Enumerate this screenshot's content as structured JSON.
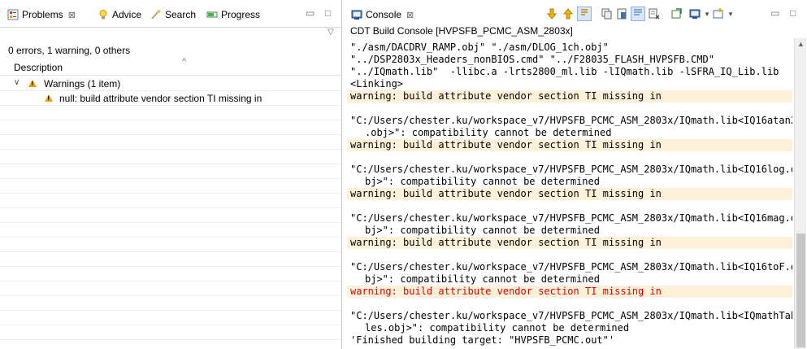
{
  "left": {
    "tabs": [
      {
        "label": "Problems",
        "close": "⊠",
        "icon": "problems-icon"
      },
      {
        "label": "Advice",
        "icon": "lightbulb-icon"
      },
      {
        "label": "Search",
        "icon": "search-icon"
      },
      {
        "label": "Progress",
        "icon": "progress-icon"
      }
    ],
    "controls": {
      "minimize": "▭",
      "maximize": "□"
    },
    "view_menu": "▽",
    "summary": "0 errors, 1 warning, 0 others",
    "column_header": "Description",
    "sort_indicator": "^",
    "tree": {
      "group_label": "Warnings (1 item)",
      "expander": "∨",
      "item_label": "null: build attribute vendor section TI missing in"
    }
  },
  "right": {
    "tab": {
      "label": "Console",
      "close": "⊠",
      "icon": "console-icon"
    },
    "toolbar": {
      "icons": [
        "arrow-down-icon",
        "arrow-up-icon",
        "scroll-lock-icon",
        "copy-icon",
        "clear-icon",
        "word-wrap-icon",
        "remove-icon",
        "pin-icon",
        "display-console-icon",
        "open-console-icon"
      ],
      "dropdown": "▾",
      "minimize": "▭",
      "maximize": "□",
      "colors": {
        "arrow": "#e8a100",
        "selected_bg": "#d7e6fa",
        "warning_text": "#e00000",
        "warning_bg": "#fdf2d9"
      }
    },
    "console_title": "CDT Build Console [HVPSFB_PCMC_ASM_2803x]",
    "lines": [
      "\"./asm/DACDRV_RAMP.obj\" \"./asm/DLOG_1ch.obj\"",
      "\"../DSP2803x_Headers_nonBIOS.cmd\" \"../F28035_FLASH_HVPSFB.CMD\"",
      "\"../IQmath.lib\"  -llibc.a -lrts2800_ml.lib -lIQmath.lib -lSFRA_IQ_Lib.lib",
      "<Linking>",
      "warning: build attribute vendor section TI missing in",
      "",
      "\"C:/Users/chester.ku/workspace_v7/HVPSFB_PCMC_ASM_2803x/IQmath.lib<IQ16atan2",
      ".obj>\": compatibility cannot be determined",
      "warning: build attribute vendor section TI missing in",
      "",
      "\"C:/Users/chester.ku/workspace_v7/HVPSFB_PCMC_ASM_2803x/IQmath.lib<IQ16log.o",
      "bj>\": compatibility cannot be determined",
      "warning: build attribute vendor section TI missing in",
      "",
      "\"C:/Users/chester.ku/workspace_v7/HVPSFB_PCMC_ASM_2803x/IQmath.lib<IQ16mag.o",
      "bj>\": compatibility cannot be determined",
      "warning: build attribute vendor section TI missing in",
      "",
      "\"C:/Users/chester.ku/workspace_v7/HVPSFB_PCMC_ASM_2803x/IQmath.lib<IQ16toF.o",
      "bj>\": compatibility cannot be determined",
      "warning: build attribute vendor section TI missing in",
      "",
      "\"C:/Users/chester.ku/workspace_v7/HVPSFB_PCMC_ASM_2803x/IQmath.lib<IQmathTab",
      "les.obj>\": compatibility cannot be determined",
      "'Finished building target: \"HVPSFB_PCMC.out\"'"
    ],
    "scroll_up": "▲"
  }
}
